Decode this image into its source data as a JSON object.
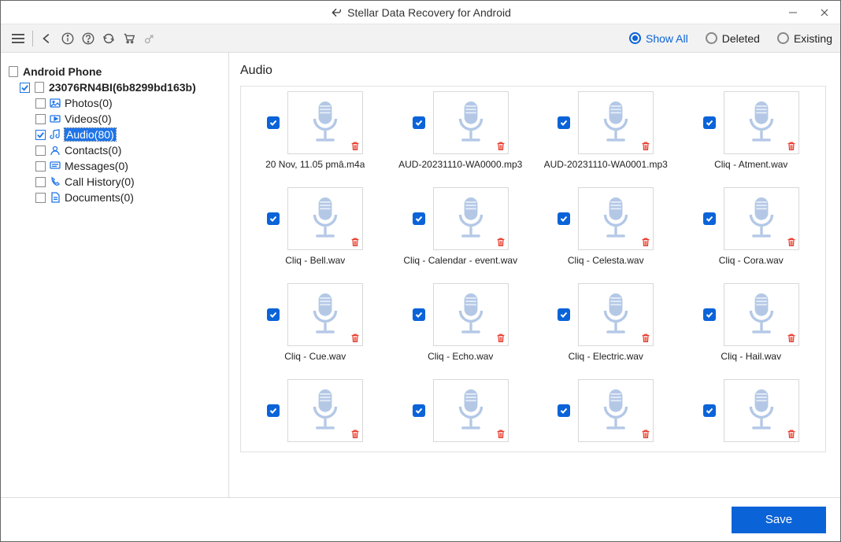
{
  "title": "Stellar Data Recovery for Android",
  "filters": {
    "show_all": "Show All",
    "deleted": "Deleted",
    "existing": "Existing",
    "selected": "show_all"
  },
  "tree": {
    "root": "Android Phone",
    "device": "23076RN4BI(6b8299bd163b)",
    "categories": [
      {
        "label": "Photos(0)",
        "key": "photos",
        "checked": false
      },
      {
        "label": "Videos(0)",
        "key": "videos",
        "checked": false
      },
      {
        "label": "Audio(80)",
        "key": "audio",
        "checked": true,
        "selected": true
      },
      {
        "label": "Contacts(0)",
        "key": "contacts",
        "checked": false
      },
      {
        "label": "Messages(0)",
        "key": "messages",
        "checked": false
      },
      {
        "label": "Call History(0)",
        "key": "callhistory",
        "checked": false
      },
      {
        "label": "Documents(0)",
        "key": "documents",
        "checked": false
      }
    ]
  },
  "content_header": "Audio",
  "items": [
    {
      "name": "20 Nov, 11.05 pmâ.m4a"
    },
    {
      "name": "AUD-20231110-WA0000.mp3"
    },
    {
      "name": "AUD-20231110-WA0001.mp3"
    },
    {
      "name": "Cliq - Atment.wav"
    },
    {
      "name": "Cliq - Bell.wav"
    },
    {
      "name": "Cliq - Calendar - event.wav"
    },
    {
      "name": "Cliq - Celesta.wav"
    },
    {
      "name": "Cliq - Cora.wav"
    },
    {
      "name": "Cliq - Cue.wav"
    },
    {
      "name": "Cliq - Echo.wav"
    },
    {
      "name": "Cliq - Electric.wav"
    },
    {
      "name": "Cliq - Hail.wav"
    },
    {
      "name": ""
    },
    {
      "name": ""
    },
    {
      "name": ""
    },
    {
      "name": ""
    }
  ],
  "footer": {
    "save_label": "Save"
  }
}
